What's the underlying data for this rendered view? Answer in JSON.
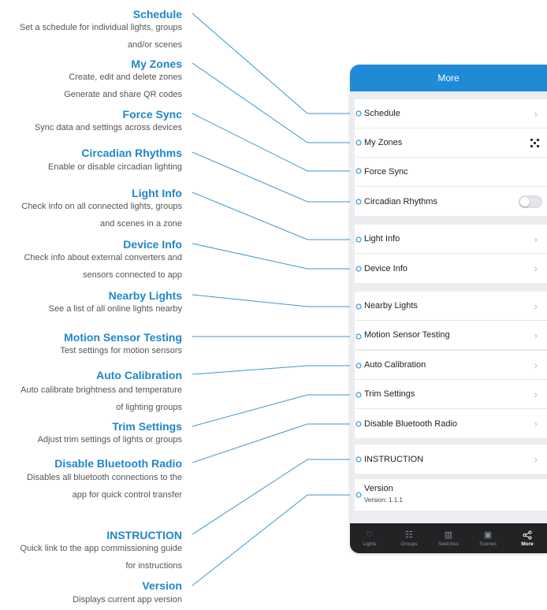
{
  "annotations": [
    {
      "title": "Schedule",
      "lines": [
        "Set a schedule for individual lights, groups",
        "and/or scenes"
      ]
    },
    {
      "title": "My Zones",
      "lines": [
        "Create, edit and delete zones",
        "Generate and share QR codes"
      ]
    },
    {
      "title": "Force Sync",
      "lines": [
        "Sync data and settings across devices"
      ]
    },
    {
      "title": "Circadian Rhythms",
      "lines": [
        "Enable or disable circadian lighting"
      ]
    },
    {
      "title": "Light Info",
      "lines": [
        "Check info on all connected lights, groups",
        "and scenes in a zone"
      ]
    },
    {
      "title": "Device Info",
      "lines": [
        "Check info about external converters and",
        "sensors connected to app"
      ]
    },
    {
      "title": "Nearby Lights",
      "lines": [
        "See a list of all online lights nearby"
      ]
    },
    {
      "title": "Motion Sensor Testing",
      "lines": [
        "Test settings for motion sensors"
      ]
    },
    {
      "title": "Auto Calibration",
      "lines": [
        "Auto calibrate brightness and temperature",
        "of lighting groups"
      ]
    },
    {
      "title": "Trim Settings",
      "lines": [
        "Adjust trim settings of lights or groups"
      ]
    },
    {
      "title": "Disable Bluetooth Radio",
      "lines": [
        "Disables all bluetooth connections to the",
        "app for quick control transfer"
      ]
    },
    {
      "title": "INSTRUCTION",
      "lines": [
        "Quick link to the app commissioning guide",
        "for instructions"
      ]
    },
    {
      "title": "Version",
      "lines": [
        "Displays current app version"
      ]
    }
  ],
  "phone": {
    "header_title": "More",
    "menu": [
      {
        "label": "Schedule",
        "trailing": "chevron"
      },
      {
        "label": "My Zones",
        "trailing": "qr-code-icon"
      },
      {
        "label": "Force Sync",
        "trailing": "none"
      },
      {
        "label": "Circadian Rhythms",
        "trailing": "toggle",
        "toggle_on": false
      },
      {
        "label": "Light Info",
        "trailing": "chevron"
      },
      {
        "label": "Device Info",
        "trailing": "chevron"
      },
      {
        "label": "Nearby Lights",
        "trailing": "chevron"
      },
      {
        "label": "Motion Sensor Testing",
        "trailing": "chevron"
      },
      {
        "label": "Auto Calibration",
        "trailing": "chevron"
      },
      {
        "label": "Trim Settings",
        "trailing": "chevron"
      },
      {
        "label": "Disable Bluetooth Radio",
        "trailing": "chevron"
      },
      {
        "label": "INSTRUCTION",
        "trailing": "chevron"
      },
      {
        "label": "Version",
        "sublabel": "Version: 1.1.1",
        "trailing": "none"
      }
    ],
    "chevron": "›",
    "tabs": [
      {
        "label": "Lights",
        "icon": "lightbulb-icon",
        "active": false
      },
      {
        "label": "Groups",
        "icon": "groups-icon",
        "active": false
      },
      {
        "label": "Switches",
        "icon": "switches-icon",
        "active": false
      },
      {
        "label": "Scenes",
        "icon": "scenes-icon",
        "active": false
      },
      {
        "label": "More",
        "icon": "share-nodes-icon",
        "active": true
      }
    ]
  },
  "colors": {
    "accent": "#1f86c8",
    "header": "#1f8ad6",
    "tabbar": "#222325",
    "connector": "#3a97d6"
  }
}
